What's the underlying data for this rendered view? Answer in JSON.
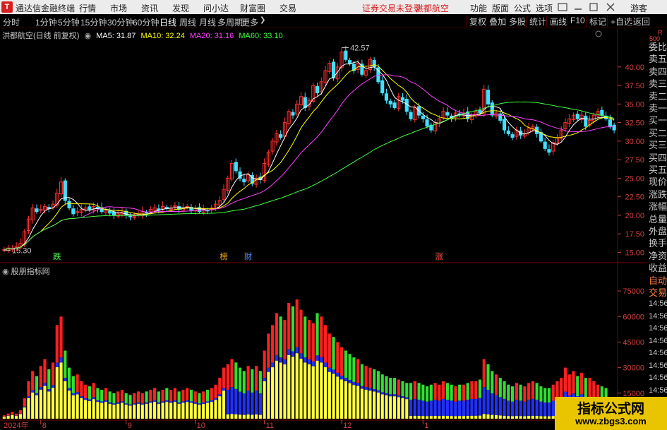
{
  "app": {
    "logo": "T",
    "name": "通达信金融终端",
    "menu": [
      "行情",
      "市场",
      "资讯",
      "发现",
      "问小达",
      "财富圈",
      "交易"
    ],
    "notice": "证券交易未登录",
    "stock_tab": "洪都航空",
    "right_menu": [
      "功能",
      "版面",
      "公式",
      "选项"
    ],
    "user": "游客"
  },
  "periods": [
    "分时",
    "1分钟",
    "5分钟",
    "15分钟",
    "30分钟",
    "60分钟",
    "日线",
    "周线",
    "月线",
    "多周期",
    "更多"
  ],
  "active_period": "日线",
  "toolbar": [
    "复权",
    "叠加",
    "多股",
    "统计",
    "画线",
    "F10",
    "标记",
    "+自选",
    "返回"
  ],
  "legend": {
    "title": "洪都航空(日线 前复权)",
    "ma": [
      {
        "label": "MA5: 31.87",
        "color": "#ffffff"
      },
      {
        "label": "MA10: 32.24",
        "color": "#ffff00"
      },
      {
        "label": "MA20: 31.16",
        "color": "#ff40ff"
      },
      {
        "label": "MA60: 33.10",
        "color": "#40ff40"
      }
    ]
  },
  "indicator_label": "股朋指标网",
  "price_axis": [
    "40.00",
    "37.50",
    "35.00",
    "32.50",
    "30.00",
    "27.50",
    "25.00",
    "22.50",
    "20.00",
    "17.50",
    "15.00"
  ],
  "volume_axis": [
    "75000",
    "60000",
    "45000",
    "30000",
    "15000"
  ],
  "annotations": {
    "high": "42.57",
    "low": "15.30"
  },
  "events": [
    {
      "label": "跌",
      "color": "#40ff40"
    },
    {
      "label": "榜",
      "color": "#e8a000"
    },
    {
      "label": "财",
      "color": "#4080ff"
    },
    {
      "label": "涨",
      "color": "#ff4040"
    }
  ],
  "dates": [
    "2024年",
    "8",
    "9",
    "10",
    "11",
    "12",
    "1"
  ],
  "right_panel": {
    "header": [
      "R",
      "500"
    ],
    "items": [
      "委比",
      "卖五",
      "卖四",
      "卖三",
      "卖二",
      "卖一",
      "买一",
      "买二",
      "买三",
      "买四",
      "买五",
      "现价",
      "涨跌",
      "涨幅",
      "总量",
      "外盘",
      "换手",
      "净资",
      "收益",
      "自动",
      "交易"
    ],
    "times": [
      "14:56",
      "14:56",
      "14:56",
      "14:56",
      "14:56",
      "14:56",
      "14:56",
      "14:56"
    ]
  },
  "watermark": {
    "title": "指标公式网",
    "url": "www.zbgs3.com"
  },
  "chart_data": {
    "type": "candlestick",
    "price_ylim": [
      14.0,
      43.5
    ],
    "volume_ylim": [
      0,
      85000
    ],
    "series_colors": {
      "up": "#ff3030",
      "down": "#40e0ff",
      "ma5": "#ffffff",
      "ma10": "#ffff00",
      "ma20": "#ff40ff",
      "ma60": "#40ff40"
    },
    "closes": [
      15.4,
      15.6,
      15.5,
      15.8,
      16.2,
      17.8,
      19.5,
      21.0,
      20.5,
      20.8,
      21.2,
      20.9,
      21.5,
      23.0,
      24.5,
      22.0,
      21.0,
      20.2,
      20.5,
      20.8,
      21.0,
      20.8,
      21.2,
      20.9,
      20.5,
      20.7,
      20.3,
      20.0,
      20.2,
      20.4,
      20.0,
      19.8,
      19.9,
      20.1,
      20.5,
      20.3,
      20.8,
      21.0,
      20.7,
      21.2,
      20.9,
      21.0,
      21.3,
      20.8,
      21.0,
      21.2,
      20.7,
      20.9,
      20.5,
      20.8,
      20.6,
      21.0,
      21.5,
      22.0,
      23.5,
      25.0,
      27.0,
      26.0,
      25.0,
      24.5,
      25.5,
      24.3,
      25.0,
      24.8,
      27.0,
      28.5,
      30.0,
      31.0,
      30.5,
      32.5,
      34.0,
      33.5,
      35.0,
      36.0,
      34.5,
      35.5,
      37.5,
      36.5,
      38.0,
      39.5,
      40.5,
      38.5,
      40.0,
      42.0,
      41.0,
      40.5,
      39.5,
      40.5,
      39.0,
      39.5,
      41.0,
      40.0,
      38.0,
      36.5,
      35.5,
      35.0,
      34.5,
      36.0,
      35.5,
      34.0,
      33.0,
      34.5,
      33.5,
      33.0,
      32.0,
      31.5,
      32.5,
      33.0,
      34.0,
      33.5,
      33.0,
      33.8,
      33.5,
      33.8,
      33.0,
      33.5,
      34.0,
      33.8,
      37.0,
      35.0,
      33.5,
      33.8,
      32.8,
      31.5,
      31.0,
      30.5,
      31.5,
      30.8,
      31.0,
      31.8,
      32.0,
      31.0,
      30.0,
      29.0,
      28.5,
      29.8,
      30.5,
      31.5,
      32.5,
      33.0,
      33.5,
      33.0,
      33.5,
      32.0,
      32.8,
      33.5,
      34.0,
      33.5,
      33.0,
      32.0,
      31.5
    ],
    "volumes": [
      2,
      3,
      4,
      3,
      5,
      12,
      22,
      28,
      25,
      31,
      35,
      29,
      33,
      55,
      60,
      40,
      30,
      25,
      26,
      22,
      20,
      19,
      21,
      18,
      17,
      18,
      16,
      15,
      16,
      17,
      15,
      14,
      15,
      16,
      15,
      16,
      17,
      18,
      16,
      17,
      18,
      17,
      18,
      16,
      17,
      18,
      17,
      16,
      15,
      16,
      17,
      18,
      20,
      24,
      30,
      32,
      35,
      33,
      30,
      28,
      31,
      29,
      31,
      28,
      40,
      50,
      55,
      62,
      60,
      58,
      68,
      66,
      70,
      64,
      60,
      58,
      56,
      62,
      60,
      55,
      50,
      48,
      45,
      42,
      40,
      38,
      36,
      35,
      32,
      31,
      30,
      29,
      28,
      26,
      25,
      24,
      24,
      23,
      22,
      21,
      21,
      22,
      21,
      20,
      19,
      20,
      21,
      20,
      22,
      21,
      20,
      19,
      20,
      20,
      21,
      22,
      22,
      23,
      35,
      32,
      28,
      26,
      24,
      22,
      20,
      19,
      21,
      20,
      19,
      21,
      22,
      21,
      19,
      18,
      18,
      20,
      22,
      24,
      30,
      26,
      28,
      25,
      27,
      24,
      24,
      22,
      20,
      19,
      18
    ]
  }
}
